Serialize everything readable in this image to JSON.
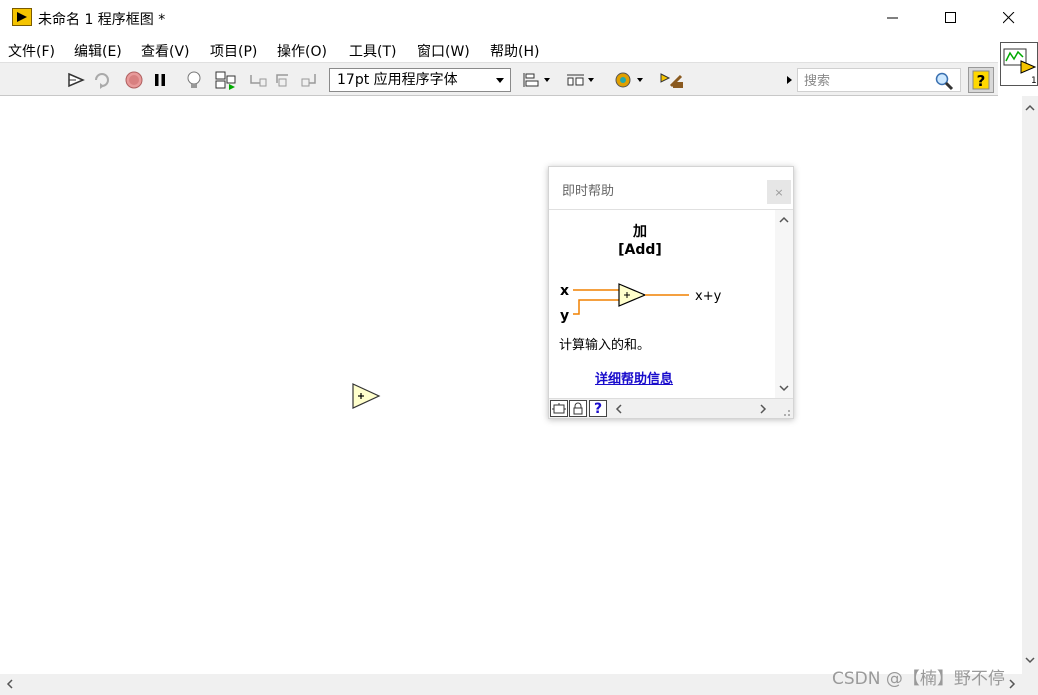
{
  "window": {
    "title": "未命名 1 程序框图 *"
  },
  "menu": {
    "items": [
      "文件(F)",
      "编辑(E)",
      "查看(V)",
      "项目(P)",
      "操作(O)",
      "工具(T)",
      "窗口(W)",
      "帮助(H)"
    ]
  },
  "toolbar": {
    "font_select_value": "17pt 应用程序字体",
    "search_placeholder": "搜索",
    "help_label": "?"
  },
  "context_help": {
    "title": "即时帮助",
    "close_label": "×",
    "function_name": "加",
    "function_english": "[Add]",
    "input_x": "x",
    "input_y": "y",
    "output": "x+y",
    "description": "计算输入的和。",
    "link": "详细帮助信息"
  },
  "watermark": "CSDN @【楠】野不停",
  "colors": {
    "wire_orange": "#f08000",
    "node_fill": "#ffffcc",
    "link_blue": "#1a0dcc",
    "app_icon_yellow": "#f5c400"
  }
}
